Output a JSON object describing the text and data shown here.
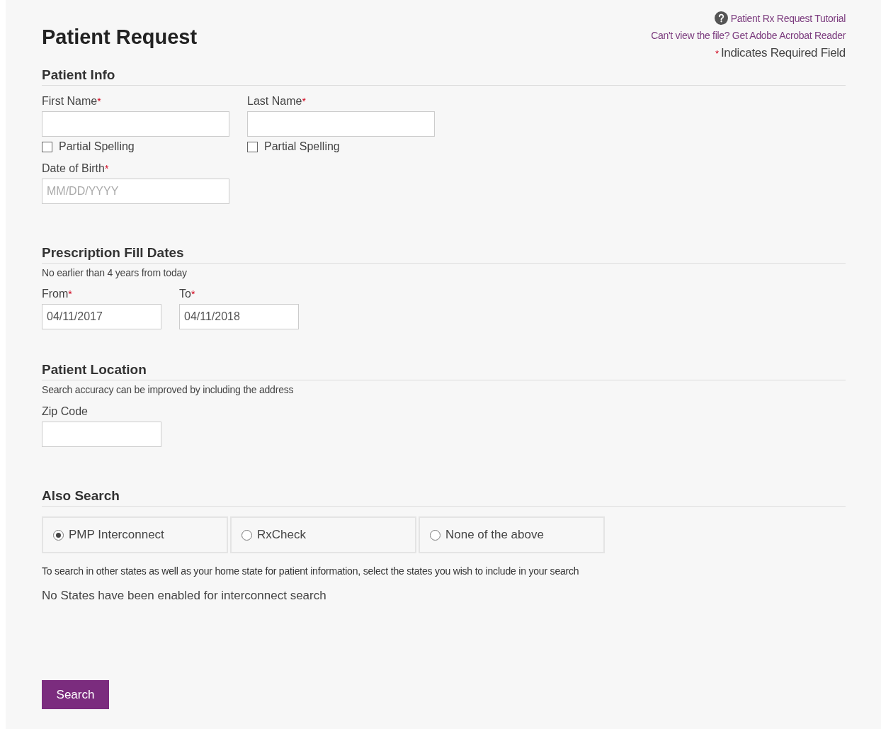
{
  "title": "Patient Request",
  "links": [
    {
      "kind": "help",
      "text": "Patient Rx Request Tutorial"
    },
    {
      "kind": "plain",
      "text": "Can't view the file? Get Adobe Acrobat Reader"
    }
  ],
  "legend": {
    "required_mark": "*",
    "text": "Indicates Required Field"
  },
  "patient_info": {
    "heading": "Patient Info",
    "name_fields": [
      {
        "label": "First Name",
        "required_mark": "*",
        "checkbox": {
          "label": "Partial Spelling",
          "checked": false
        }
      },
      {
        "label": "Last Name",
        "required_mark": "*",
        "checkbox": {
          "label": "Partial Spelling",
          "checked": false
        }
      }
    ],
    "dob": {
      "label": "Date of Birth",
      "required_mark": "*",
      "placeholder": "MM/DD/YYYY"
    }
  },
  "fill_dates": {
    "heading": "Prescription Fill Dates",
    "note": "No earlier than 4 years from today",
    "fields": [
      {
        "label": "From",
        "required_mark": "*",
        "value": "04/11/2017"
      },
      {
        "label": "To",
        "required_mark": "*",
        "value": "04/11/2018"
      }
    ]
  },
  "location": {
    "heading": "Patient Location",
    "note": "Search accuracy can be improved by including the address",
    "zip": {
      "label": "Zip Code"
    }
  },
  "also_search": {
    "heading": "Also Search",
    "options": [
      {
        "label": "PMP Interconnect",
        "selected": true
      },
      {
        "label": "RxCheck",
        "selected": false
      },
      {
        "label": "None of the above",
        "selected": false
      }
    ],
    "note": "To search in other states as well as your home state for patient information, select the states you wish to include in your search",
    "message": "No States have been enabled for interconnect search"
  },
  "search_button": "Search"
}
